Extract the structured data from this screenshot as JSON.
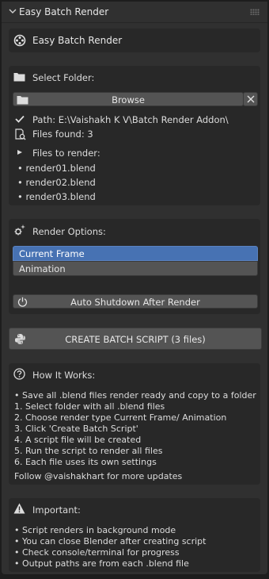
{
  "panel": {
    "title": "Easy Batch Render"
  },
  "addon_header": {
    "title": "Easy Batch Render"
  },
  "folder": {
    "section_label": "Select Folder:",
    "browse_label": "Browse",
    "path_text": "Path: E:\\Vaishakh K V\\Batch Render Addon\\",
    "files_found_text": "Files found: 3",
    "files_to_render_label": "Files to render:",
    "files": [
      "render01.blend",
      "render02.blend",
      "render03.blend"
    ]
  },
  "render_options": {
    "section_label": "Render Options:",
    "options": [
      "Current Frame",
      "Animation"
    ],
    "selected": "Current Frame",
    "shutdown_label": "Auto Shutdown After Render"
  },
  "create_button": {
    "label": "CREATE BATCH SCRIPT (3 files)"
  },
  "how_it_works": {
    "title": "How It Works:",
    "lines": [
      "• Save all .blend files render ready and copy to a folder",
      "1. Select folder with all .blend files",
      "2. Choose render type Current Frame/ Animation",
      "3. Click 'Create Batch Script'",
      "4. A script file will be created",
      "5. Run the script to render all files",
      "6. Each file uses its own settings"
    ],
    "follow_text": "Follow @vaishakhart for more updates"
  },
  "important": {
    "title": "Important:",
    "lines": [
      "• Script renders in background mode",
      "• You can close Blender after creating script",
      "• Check console/terminal for progress",
      "• Output paths are from each .blend file"
    ]
  },
  "colors": {
    "accent_selected": "#4772b3",
    "panel_bg": "#303030",
    "box_bg": "#282828",
    "button_bg": "#545454"
  }
}
